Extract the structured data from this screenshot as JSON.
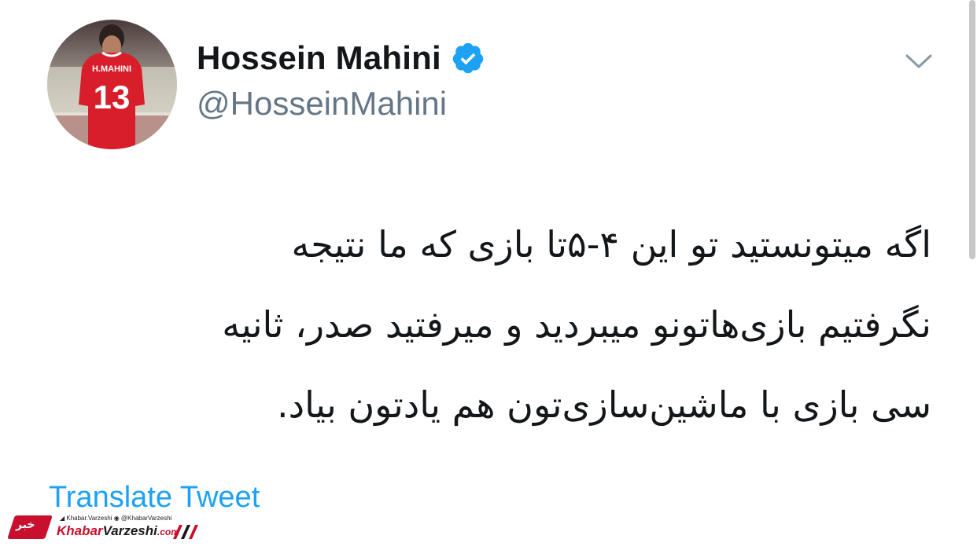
{
  "profile": {
    "display_name": "Hossein Mahini",
    "handle": "@HosseinMahini",
    "verified": true,
    "avatar_icon": "profile-photo-red-jersey",
    "jersey_name": "H.MAHINI",
    "jersey_number": "13"
  },
  "tweet": {
    "lines": [
      "اگه میتونستید تو این ۴-۵تا بازی که ما نتیجه",
      "نگرفتیم بازی‌هاتونو میبردید و میرفتید صدر، ثانیه",
      "سی بازی با ماشین‌سازی‌تون هم یادتون بیاد."
    ]
  },
  "actions": {
    "translate_label": "Translate Tweet",
    "menu_icon": "chevron-down-icon"
  },
  "watermark": {
    "badge_text": "خبر",
    "top_text": "◢ Khabar.Varzeshi  ◉ @KhabarVarzeshi",
    "brand_part1": "Khabar",
    "brand_part2": "Varzeshi",
    "brand_suffix": ".com"
  },
  "colors": {
    "accent": "#1da1f2",
    "handle": "#657786",
    "text": "#14171a",
    "brand_red": "#c8102e"
  }
}
